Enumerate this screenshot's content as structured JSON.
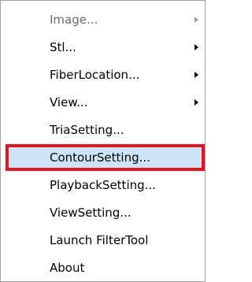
{
  "context_menu": {
    "items": [
      {
        "label": "Image...",
        "submenu": true,
        "enabled": false
      },
      {
        "label": "Stl...",
        "submenu": true,
        "enabled": true
      },
      {
        "label": "FiberLocation...",
        "submenu": true,
        "enabled": true
      },
      {
        "label": "View...",
        "submenu": true,
        "enabled": true
      },
      {
        "label": "TriaSetting...",
        "submenu": false,
        "enabled": true
      },
      {
        "label": "ContourSetting...",
        "submenu": false,
        "enabled": true,
        "highlighted": true
      },
      {
        "label": "PlaybackSetting...",
        "submenu": false,
        "enabled": true
      },
      {
        "label": "ViewSetting...",
        "submenu": false,
        "enabled": true
      },
      {
        "label": "Launch FilterTool",
        "submenu": false,
        "enabled": true
      },
      {
        "label": "About",
        "submenu": false,
        "enabled": true
      }
    ]
  },
  "colors": {
    "highlight_fill": "#cce4f7",
    "highlight_border": "#e8121d",
    "disabled_text": "#6d6d6d"
  }
}
